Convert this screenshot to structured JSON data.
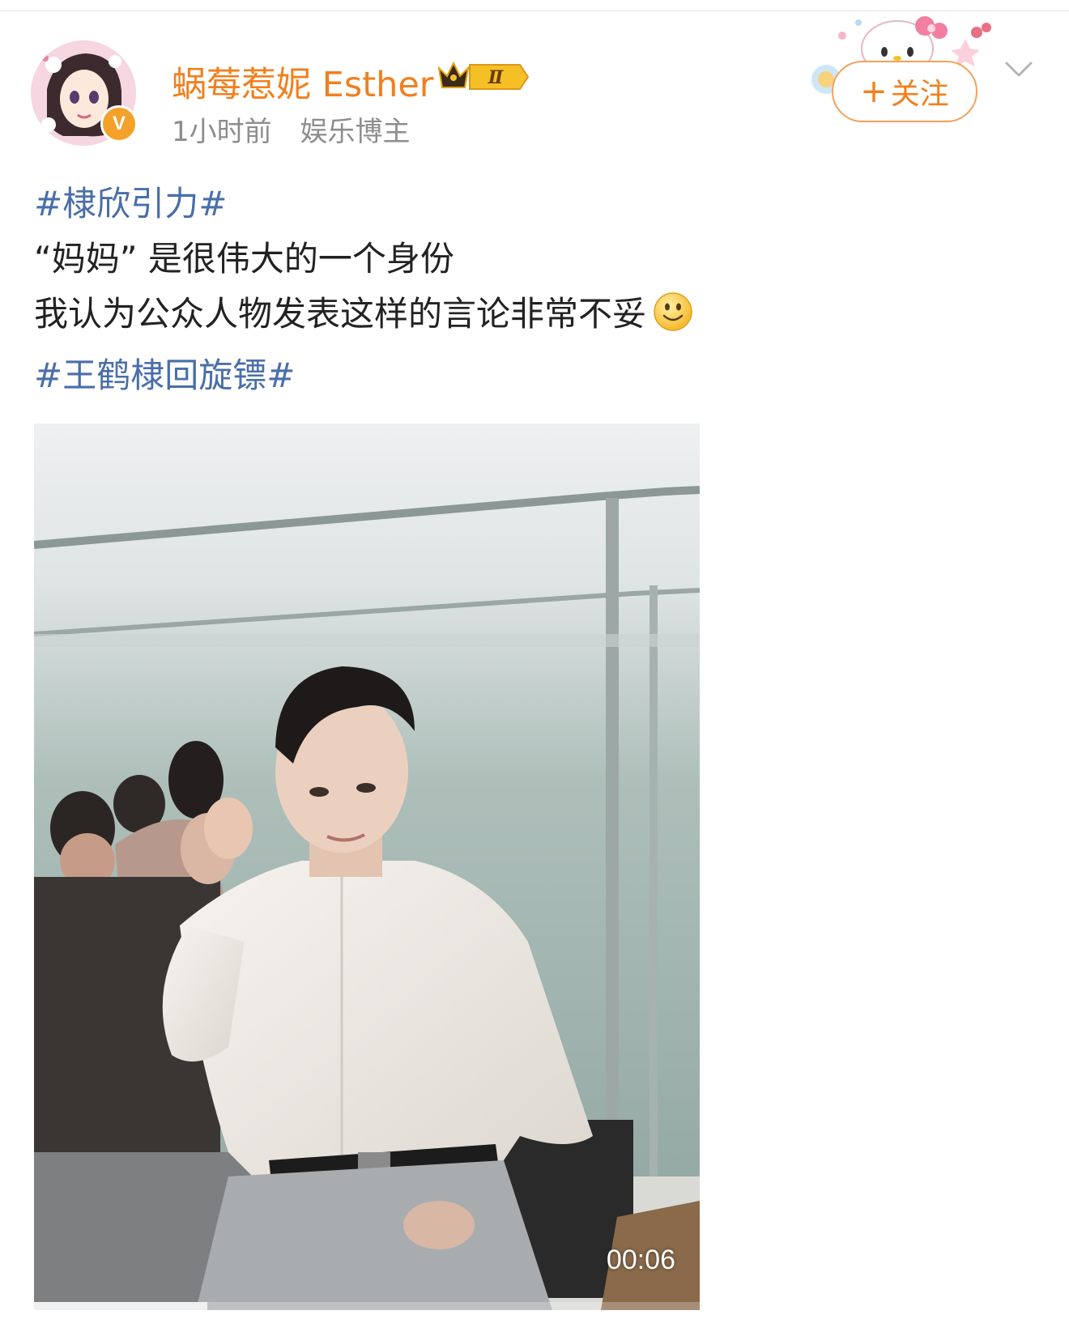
{
  "author": {
    "name": "蜗莓惹妮 Esther",
    "time": "1小时前",
    "category": "娱乐博主",
    "verified_badge": "V",
    "member_level": "Ⅱ"
  },
  "follow_button": {
    "plus": "+",
    "label": "关注"
  },
  "post": {
    "line1_topic": "#棣欣引力#",
    "line2": "“妈妈” 是很伟大的一个身份",
    "line3": " 我认为公众人物发表这样的言论非常不妥",
    "line4_topic": "#王鹤棣回旋镖#"
  },
  "video": {
    "duration": "00:06",
    "progress_fraction": 0.26
  },
  "colors": {
    "author_name": "#f27f1d",
    "topic_link": "#4a6fa8",
    "meta_text": "#8d8d8d",
    "follow_border": "#f4a05c"
  },
  "icons": [
    "crown-icon",
    "smile-emoji-icon",
    "chevron-down-icon",
    "verified-v-icon",
    "hello-kitty-decoration"
  ]
}
